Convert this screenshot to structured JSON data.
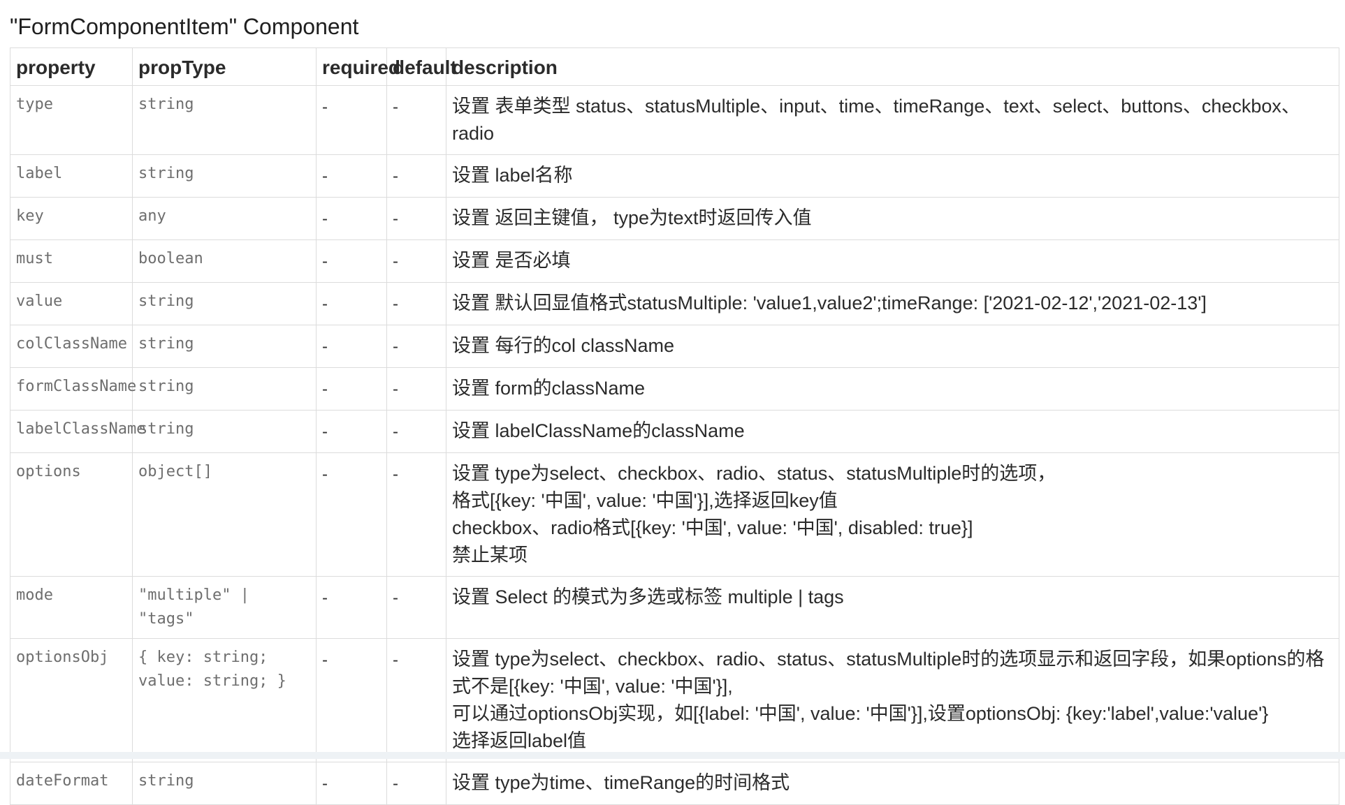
{
  "title": "\"FormComponentItem\" Component",
  "columns": [
    "property",
    "propType",
    "required",
    "default",
    "description"
  ],
  "rows": [
    {
      "property": "type",
      "propType": "string",
      "required": "-",
      "default": "-",
      "description": [
        "设置 表单类型 status、statusMultiple、input、time、timeRange、text、select、buttons、checkbox、radio"
      ]
    },
    {
      "property": "label",
      "propType": "string",
      "required": "-",
      "default": "-",
      "description": [
        "设置 label名称"
      ]
    },
    {
      "property": "key",
      "propType": "any",
      "required": "-",
      "default": "-",
      "description": [
        "设置 返回主键值， type为text时返回传入值"
      ]
    },
    {
      "property": "must",
      "propType": "boolean",
      "required": "-",
      "default": "-",
      "description": [
        "设置 是否必填"
      ]
    },
    {
      "property": "value",
      "propType": "string",
      "required": "-",
      "default": "-",
      "description": [
        "设置 默认回显值格式statusMultiple: 'value1,value2';timeRange: ['2021-02-12','2021-02-13']"
      ]
    },
    {
      "property": "colClassName",
      "propType": "string",
      "required": "-",
      "default": "-",
      "description": [
        "设置 每行的col className"
      ]
    },
    {
      "property": "formClassName",
      "propType": "string",
      "required": "-",
      "default": "-",
      "description": [
        "设置 form的className"
      ]
    },
    {
      "property": "labelClassName",
      "propType": "string",
      "required": "-",
      "default": "-",
      "description": [
        "设置 labelClassName的className"
      ]
    },
    {
      "property": "options",
      "propType": "object[]",
      "required": "-",
      "default": "-",
      "description": [
        "设置 type为select、checkbox、radio、status、statusMultiple时的选项，",
        "格式[{key: '中国', value: '中国'}],选择返回key值",
        "checkbox、radio格式[{key: '中国', value: '中国', disabled: true}]",
        "禁止某项"
      ]
    },
    {
      "property": "mode",
      "propType": "\"multiple\" | \"tags\"",
      "required": "-",
      "default": "-",
      "description": [
        "设置 Select 的模式为多选或标签 multiple | tags"
      ]
    },
    {
      "property": "optionsObj",
      "propType": "{ key: string; value: string; }",
      "required": "-",
      "default": "-",
      "description": [
        "设置 type为select、checkbox、radio、status、statusMultiple时的选项显示和返回字段，如果options的格式不是[{key: '中国', value: '中国'}],",
        "可以通过optionsObj实现，如[{label: '中国', value: '中国'}],设置optionsObj: {key:'label',value:'value'}",
        "选择返回label值"
      ]
    },
    {
      "property": "dateFormat",
      "propType": "string",
      "required": "-",
      "default": "-",
      "description": [
        "设置 type为time、timeRange的时间格式"
      ]
    }
  ]
}
